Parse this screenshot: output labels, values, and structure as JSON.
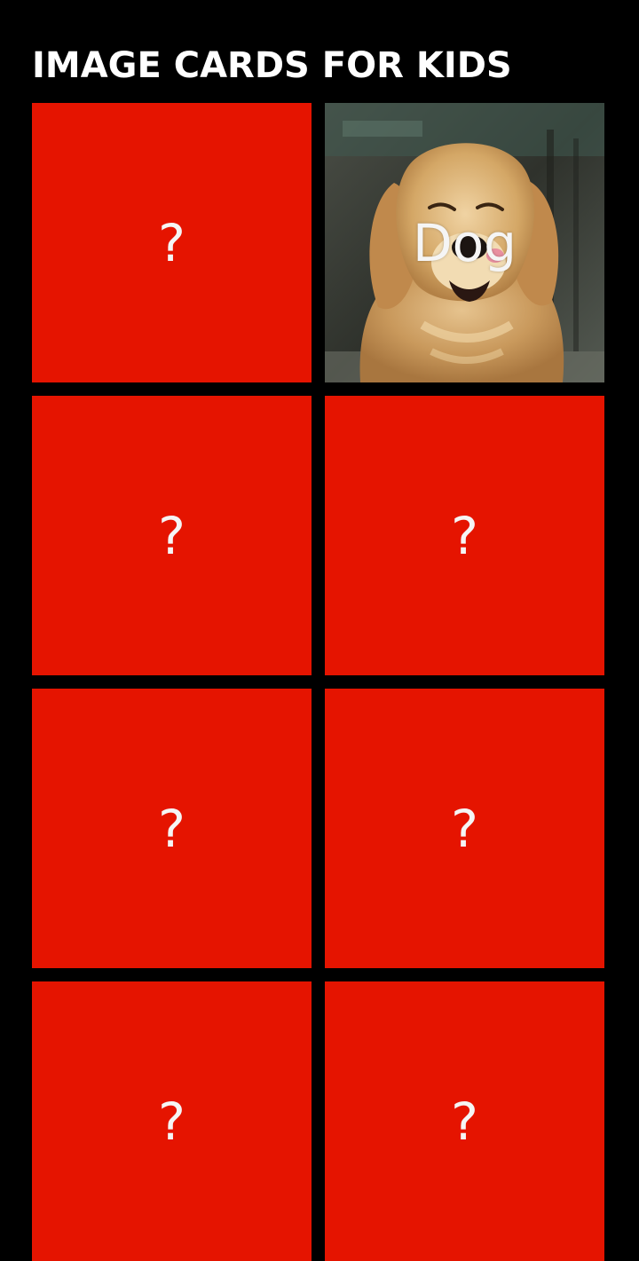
{
  "app": {
    "title": "IMAGE CARDS FOR KIDS"
  },
  "colors": {
    "background": "#000000",
    "card_back": "#e51400",
    "text": "#ffffff"
  },
  "cards": [
    {
      "label": "?",
      "state": "hidden"
    },
    {
      "label": "Dog",
      "state": "revealed",
      "image": "golden-retriever-photo"
    },
    {
      "label": "?",
      "state": "hidden"
    },
    {
      "label": "?",
      "state": "hidden"
    },
    {
      "label": "?",
      "state": "hidden"
    },
    {
      "label": "?",
      "state": "hidden"
    },
    {
      "label": "?",
      "state": "hidden"
    },
    {
      "label": "?",
      "state": "hidden"
    }
  ]
}
